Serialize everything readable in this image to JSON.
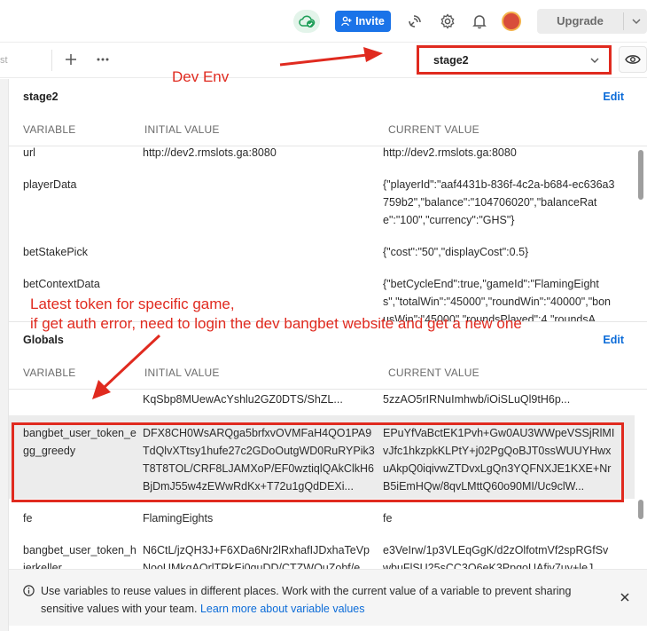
{
  "topbar": {
    "invite_label": "Invite",
    "upgrade_label": "Upgrade"
  },
  "tabbar": {
    "tab_stub": "st"
  },
  "environment": {
    "selected": "stage2"
  },
  "env_section": {
    "title": "stage2",
    "edit_label": "Edit",
    "columns": [
      "VARIABLE",
      "INITIAL VALUE",
      "CURRENT VALUE"
    ],
    "rows": [
      {
        "variable": "url",
        "initial": "http://dev2.rmslots.ga:8080",
        "current": "http://dev2.rmslots.ga:8080"
      },
      {
        "variable": "playerData",
        "initial": "",
        "current": "{\"playerId\":\"aaf4431b-836f-4c2a-b684-ec636a3759b2\",\"balance\":\"104706020\",\"balanceRate\":\"100\",\"currency\":\"GHS\"}"
      },
      {
        "variable": "betStakePick",
        "initial": "",
        "current": "{\"cost\":\"50\",\"displayCost\":0.5}"
      },
      {
        "variable": "betContextData",
        "initial": "",
        "current": "{\"betCycleEnd\":true,\"gameId\":\"FlamingEights\",\"totalWin\":\"45000\",\"roundWin\":\"40000\",\"bonusWin\":\"45000\",\"roundsPlayed\":4,\"roundsA"
      }
    ]
  },
  "globals_section": {
    "title": "Globals",
    "edit_label": "Edit",
    "columns": [
      "VARIABLE",
      "INITIAL VALUE",
      "CURRENT VALUE"
    ],
    "rows": [
      {
        "variable": "",
        "initial": "KqSbp8MUewAcYshlu2GZ0DTS/ShZL...",
        "current": "5zzAO5rIRNuImhwb/iOiSLuQl9tH6p..."
      },
      {
        "variable": "bangbet_user_token_egg_greedy",
        "initial": "DFX8CH0WsARQga5brfxvOVMFaH4QO1PA9TdQlvXTtsy1hufe27c2GDoOutgWD0RuRYPik3T8T8TOL/CRF8LJAMXoP/EF0wztiqlQAkClkH6BjDmJ55w4zEWwRdKx+T72u1gQdDEXi...",
        "current": "EPuYfVaBctEK1Pvh+Gw0AU3WWpeVSSjRlMIvJfc1hkzpkKLPtY+j02PgQoBJT0ssWUUYHwxuAkpQ0iqivwZTDvxLgQn3YQFNXJE1KXE+NrB5iEmHQw/8qvLMttQ60o90MI/Uc9clW..."
      },
      {
        "variable": "fe",
        "initial": "FlamingEights",
        "current": "fe"
      },
      {
        "variable": "bangbet_user_token_hierkeller",
        "initial": "N6CtL/jzQH3J+F6XDa6Nr2lRxhafIJDxhaTeVpNooUMkqAQrlTRkEi0quDD/CTZWQuZobf/e",
        "current": "e3VeIrw/1p3VLEqGgK/d2zOlfotmVf2spRGfSvwbuFlSU25sCC3O6eK3PpgoUAfiy7uy+leJ"
      }
    ]
  },
  "footer": {
    "message": "Use variables to reuse values in different places. Work with the current value of a variable to prevent sharing sensitive values with your team.",
    "link_label": "Learn more about variable values"
  },
  "annotations": {
    "dev_env": "Dev Env",
    "token_note_line1": "Latest token for specific game,",
    "token_note_line2": "if get auth error, need to login the dev bangbet website and get a new one"
  },
  "colors": {
    "accent_blue": "#1a73e8",
    "link_blue": "#0b6bd8",
    "annotation_red": "#e02a1f",
    "sync_green": "#1e9e58"
  },
  "icons": {
    "sync": "cloud-check-icon",
    "invite": "add-person-icon",
    "satellite": "satellite-icon",
    "settings": "gear-icon",
    "notifications": "bell-icon",
    "new_tab": "plus-icon",
    "more": "more-dots-icon",
    "env_dropdown": "chevron-down-icon",
    "quick_look": "eye-icon",
    "info": "info-icon",
    "close": "close-icon"
  }
}
